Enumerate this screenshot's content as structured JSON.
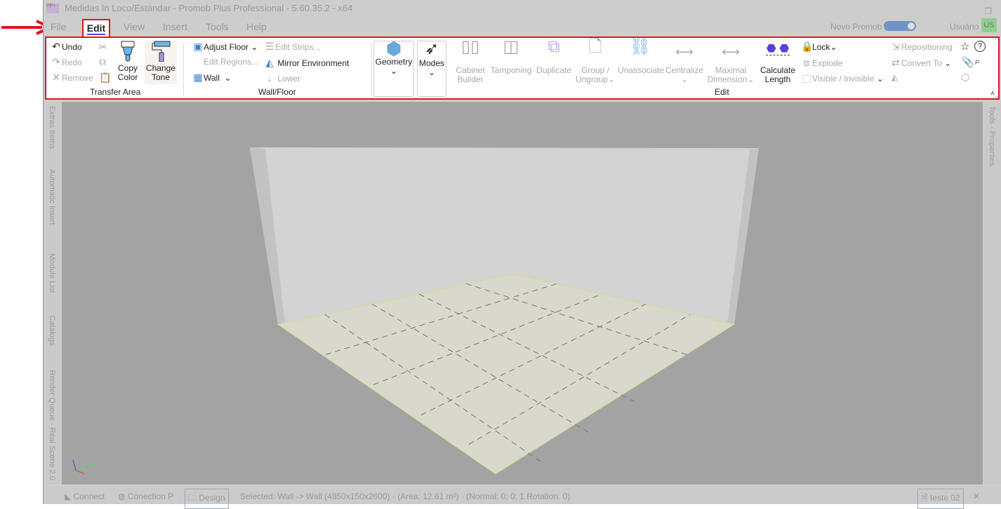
{
  "window": {
    "title": "Medidas In Loco/Estándar - Promob Plus Professional - 5.60.35.2 - x64",
    "app_icon": "PP+"
  },
  "menu": {
    "items": [
      "File",
      "Edit",
      "View",
      "Insert",
      "Tools",
      "Help"
    ],
    "active": "Edit",
    "novo_promob": "Novo Promob",
    "user": "Usuário",
    "user_initials": "US"
  },
  "ribbon": {
    "transfer_area": {
      "label": "Transfer Area",
      "undo": "Undo",
      "redo": "Redo",
      "remove": "Remove",
      "copy_color": [
        "Copy",
        "Color"
      ],
      "change_tone": [
        "Change",
        "Tone"
      ]
    },
    "wall_floor": {
      "label": "Wall/Floor",
      "adjust_floor": "Adjust Floor",
      "edit_strips": "Edit Strips...",
      "edit_regions": "Edit Regions...",
      "mirror_environment": "Mirror Environment",
      "wall": "Wall",
      "lower": "Lower"
    },
    "geometry": "Geometry",
    "modes": "Modes",
    "edit": {
      "label": "Edit",
      "cabinet_builder": [
        "Cabinet",
        "Builder"
      ],
      "tamponing": "Tamponing",
      "duplicate": "Duplicate",
      "group": [
        "Group /",
        "Ungroup"
      ],
      "unassociate": "Unassociate",
      "centralize": "Centralize",
      "maximal_dimension": [
        "Maximal",
        "Dimension"
      ],
      "calculate_length": [
        "Calculate",
        "Length"
      ],
      "lock": "Lock",
      "explode": "Explode",
      "visible_invisible": "Visible / Invisible",
      "repositioning": "Repositioning",
      "convert_to": "Convert To"
    }
  },
  "left_tabs": [
    "Extras Items",
    "Automatic Insert",
    "Module List",
    "Catalogs",
    "Render Queue - Real Scene 2.0"
  ],
  "right_tabs": [
    "Tools - Properties"
  ],
  "status": {
    "connect": "Connect",
    "conection": "Conection P",
    "design": "Design",
    "selected": "Selected: Wall -> Wall (4850x150x2600) - (Area: 12.61 m²) - (Normal: 0; 0; 1 Rotation: 0)",
    "document_tab": "teste 02"
  },
  "colors": {
    "highlight": "#e1141c",
    "accent": "#5b3fd6",
    "toggle": "#6f93c4"
  }
}
